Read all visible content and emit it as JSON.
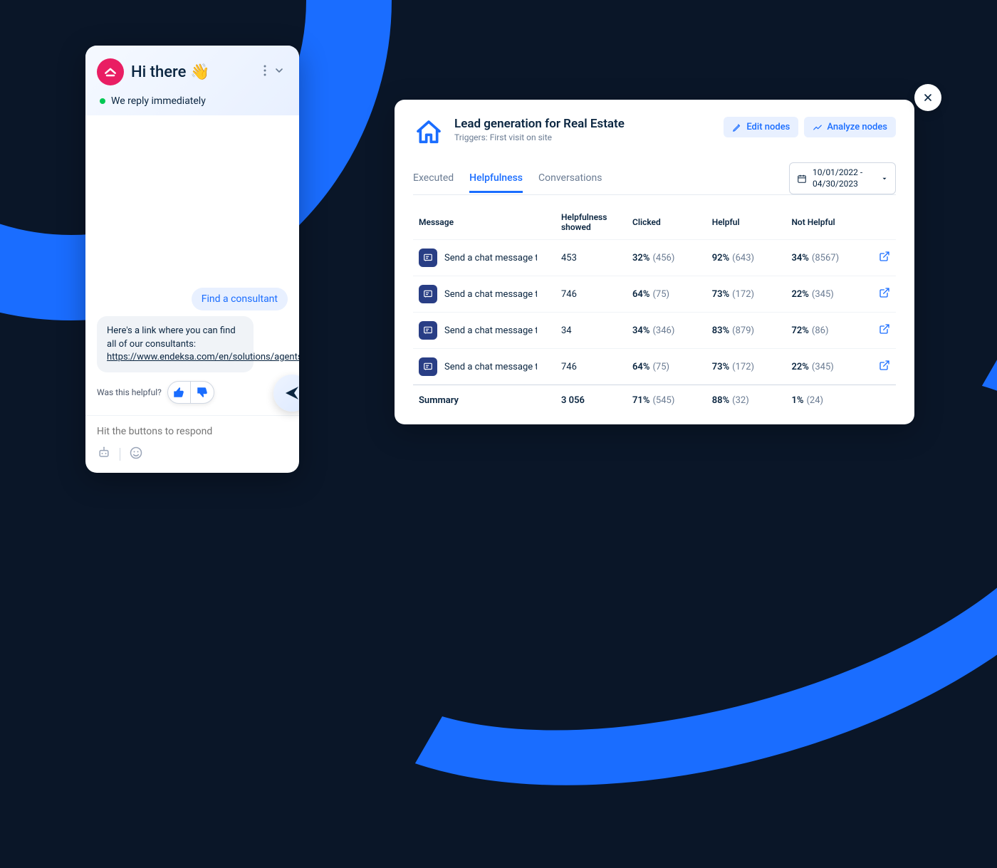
{
  "chat": {
    "title": "Hi there",
    "wave_emoji": "👋",
    "status": "We reply immediately",
    "user_message": "Find a consultant",
    "bot_message_prefix": "Here's a link where you can find all of our consultants: ",
    "bot_message_link": "https://www.endeksa.com/en/solutions/agents",
    "feedback_question": "Was this helpful?",
    "input_placeholder": "Hit the buttons to respond"
  },
  "dashboard": {
    "title": "Lead generation for Real Estate",
    "subtitle": "Triggers: First visit on site",
    "edit_nodes": "Edit nodes",
    "analyze_nodes": "Analyze nodes",
    "tabs": {
      "executed": "Executed",
      "helpfulness": "Helpfulness",
      "conversations": "Conversations"
    },
    "date_range": "10/01/2022 - 04/30/2023",
    "columns": {
      "message": "Message",
      "helpfulness_showed": "Helpfulness showed",
      "clicked": "Clicked",
      "helpful": "Helpful",
      "not_helpful": "Not Helpful"
    },
    "rows": [
      {
        "message": "Send a chat message to",
        "showed": "453",
        "clicked_pct": "32%",
        "clicked_cnt": "(456)",
        "helpful_pct": "92%",
        "helpful_cnt": "(643)",
        "not_pct": "34%",
        "not_cnt": "(8567)"
      },
      {
        "message": "Send a chat message to",
        "showed": "746",
        "clicked_pct": "64%",
        "clicked_cnt": "(75)",
        "helpful_pct": "73%",
        "helpful_cnt": "(172)",
        "not_pct": "22%",
        "not_cnt": "(345)"
      },
      {
        "message": "Send a chat message to",
        "showed": "34",
        "clicked_pct": "34%",
        "clicked_cnt": "(346)",
        "helpful_pct": "83%",
        "helpful_cnt": "(879)",
        "not_pct": "72%",
        "not_cnt": "(86)"
      },
      {
        "message": "Send a chat message to",
        "showed": "746",
        "clicked_pct": "64%",
        "clicked_cnt": "(75)",
        "helpful_pct": "73%",
        "helpful_cnt": "(172)",
        "not_pct": "22%",
        "not_cnt": "(345)"
      }
    ],
    "summary": {
      "label": "Summary",
      "showed": "3 056",
      "clicked_pct": "71%",
      "clicked_cnt": "(545)",
      "helpful_pct": "88%",
      "helpful_cnt": "(32)",
      "not_pct": "1%",
      "not_cnt": "(24)"
    }
  }
}
